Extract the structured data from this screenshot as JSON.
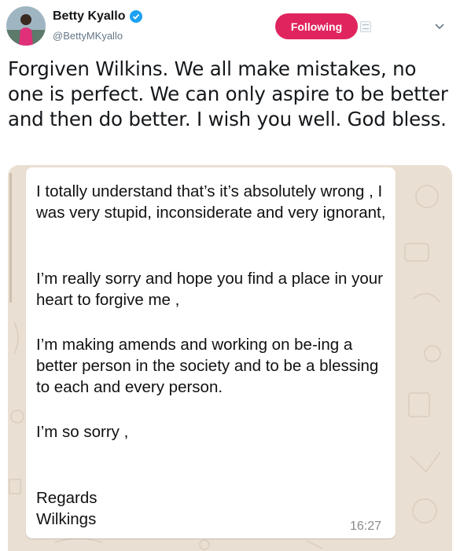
{
  "author": {
    "display_name": "Betty Kyallo",
    "handle": "@BettyMKyallo",
    "verified": true
  },
  "actions": {
    "follow_label": "Following",
    "follow_color": "#e0245e",
    "dm_icon": "envelope-icon",
    "menu_icon": "chevron-down-icon"
  },
  "tweet": {
    "text": "Forgiven Wilkins. We all make mistakes, no one is perfect. We can only aspire to be better and then do better. I wish you well. God bless."
  },
  "media": {
    "paragraphs": [
      "I totally understand that’s it’s absolutely wrong , I was very stupid, inconsiderate and very ignorant,",
      "I’m really sorry and hope you find a place in your heart to forgive me ,",
      "I’m making amends and working on be-ing a better person in the society and to be a blessing to each and every person.",
      "I’m so sorry ,",
      "Regards",
      "Wilkings"
    ],
    "time": "16:27",
    "chat_bg_color": "#e9dfd2"
  }
}
